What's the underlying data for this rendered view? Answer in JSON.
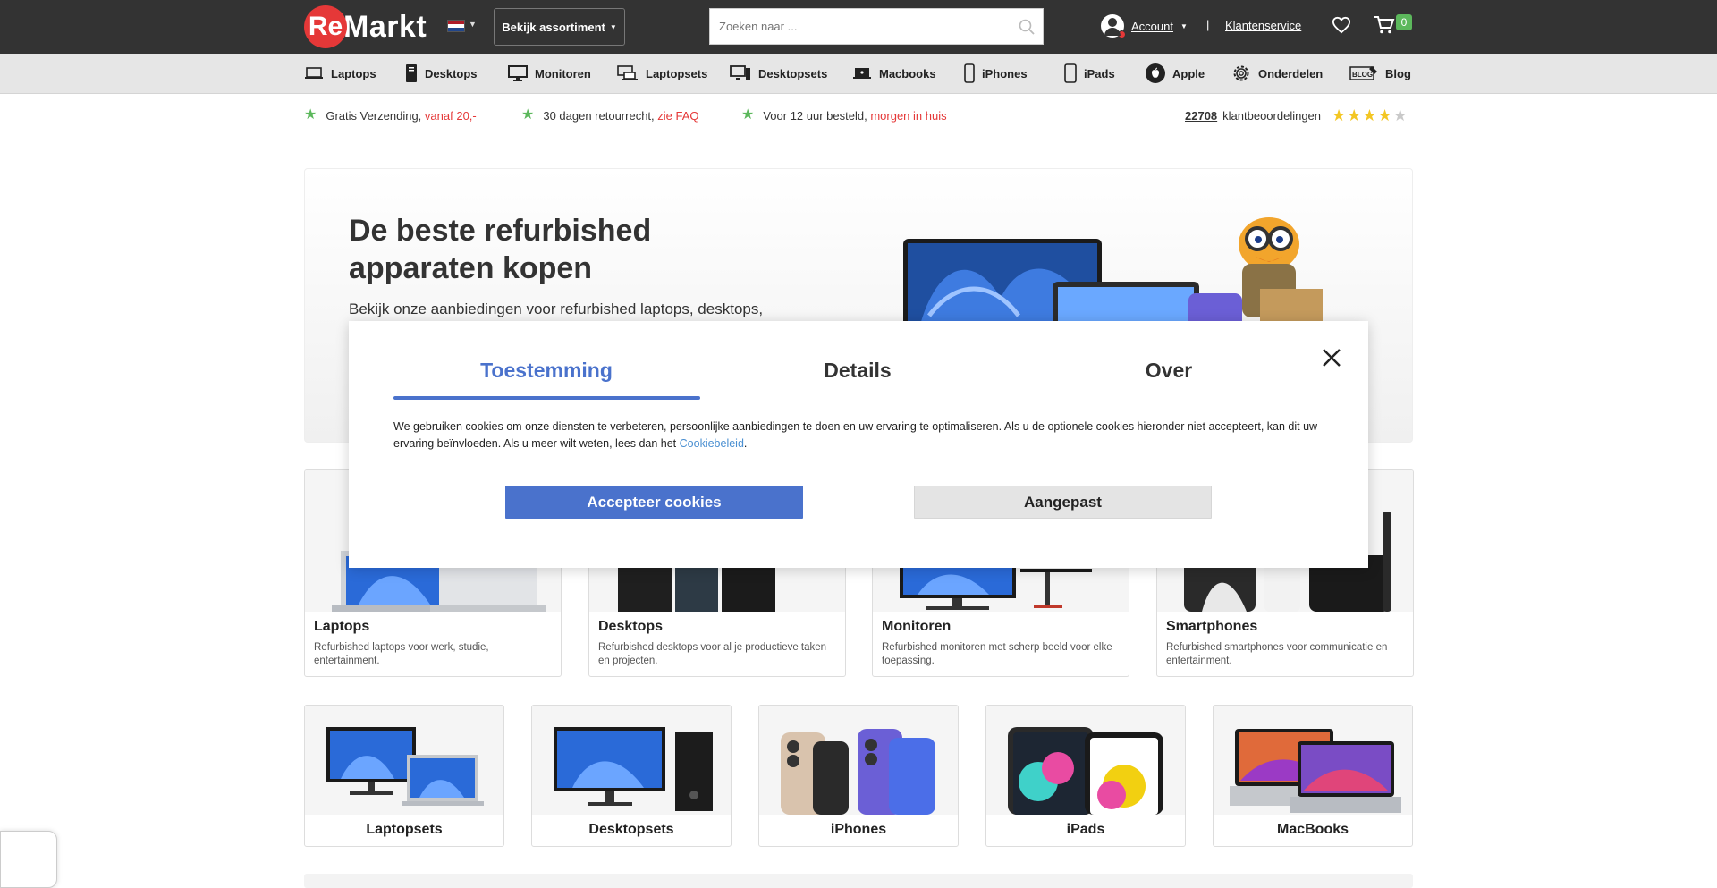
{
  "header": {
    "logo_mark": "Re",
    "logo_text": "Markt",
    "flag_colors": [
      "#ae1c28",
      "#ffffff",
      "#21468b"
    ],
    "assortment_label": "Bekijk assortiment",
    "search_placeholder": "Zoeken naar ...",
    "account_label": "Account",
    "separator": "|",
    "service_label": "Klantenservice",
    "cart_count": "0"
  },
  "nav": {
    "items": [
      {
        "label": "Laptops",
        "icon": "laptop-icon"
      },
      {
        "label": "Desktops",
        "icon": "desktop-tower-icon"
      },
      {
        "label": "Monitoren",
        "icon": "monitor-icon"
      },
      {
        "label": "Laptopsets",
        "icon": "laptopset-icon"
      },
      {
        "label": "Desktopsets",
        "icon": "desktopset-icon"
      },
      {
        "label": "Macbooks",
        "icon": "macbook-icon"
      },
      {
        "label": "iPhones",
        "icon": "iphone-icon"
      },
      {
        "label": "iPads",
        "icon": "ipad-icon"
      },
      {
        "label": "Apple",
        "icon": "apple-icon"
      },
      {
        "label": "Onderdelen",
        "icon": "gear-icon"
      },
      {
        "label": "Blog",
        "icon": "blog-icon"
      }
    ]
  },
  "usps": [
    {
      "text": "Gratis Verzending,",
      "highlight": "vanaf 20,-"
    },
    {
      "text": "30 dagen retourrecht,",
      "highlight": "zie FAQ"
    },
    {
      "text": "Voor 12 uur besteld,",
      "highlight": "morgen in huis"
    }
  ],
  "reviews": {
    "count": "22708",
    "label": "klantbeoordelingen",
    "rating_stars": 4,
    "max_stars": 5
  },
  "hero": {
    "title": "De beste refurbished apparaten kopen",
    "subtitle": "Bekijk onze aanbiedingen voor refurbished laptops, desktops,"
  },
  "categories": [
    {
      "title": "Laptops",
      "desc": "Refurbished laptops voor werk, studie, entertainment."
    },
    {
      "title": "Desktops",
      "desc": "Refurbished desktops voor al je productieve taken en projecten."
    },
    {
      "title": "Monitoren",
      "desc": "Refurbished monitoren met scherp beeld voor elke toepassing."
    },
    {
      "title": "Smartphones",
      "desc": "Refurbished smartphones voor communicatie en entertainment."
    }
  ],
  "tiles": [
    {
      "label": "Laptopsets"
    },
    {
      "label": "Desktopsets"
    },
    {
      "label": "iPhones"
    },
    {
      "label": "iPads"
    },
    {
      "label": "MacBooks"
    }
  ],
  "cookie_modal": {
    "tabs": [
      "Toestemming",
      "Details",
      "Over"
    ],
    "active_tab": "Toestemming",
    "text": "We gebruiken cookies om onze diensten te verbeteren, persoonlijke aanbiedingen te doen en uw ervaring te optimaliseren. Als u de optionele cookies hieronder niet accepteert, kan dit uw ervaring beïnvloeden. Als u meer wilt weten, lees dan het",
    "link_text": "Cookiebeleid",
    "text_end": ".",
    "accept_label": "Accepteer cookies",
    "custom_label": "Aangepast"
  },
  "colors": {
    "brand_red": "#e53838",
    "accent_blue": "#4a72cc",
    "usp_green": "#5cb85c",
    "star_yellow": "#f3c623"
  }
}
